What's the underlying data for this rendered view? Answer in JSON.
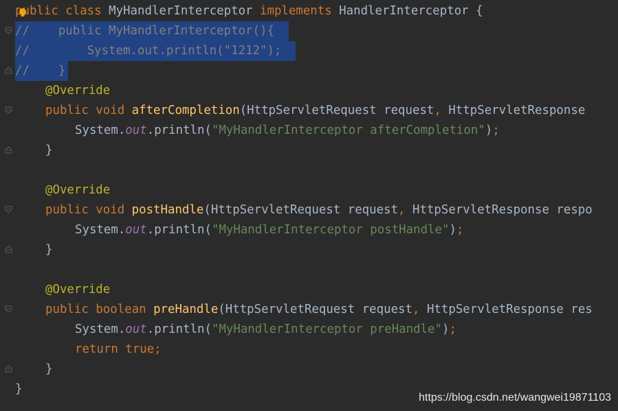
{
  "editor": {
    "lines": [
      {
        "t": "public",
        "c": "kw"
      },
      {
        "t": "class",
        "c": "kw"
      },
      {
        "t": "MyHandlerInterceptor",
        "c": ""
      },
      {
        "t": "implements",
        "c": "kw"
      },
      {
        "t": "HandlerInterceptor",
        "c": ""
      },
      {
        "t": "{",
        "c": ""
      }
    ],
    "code": {
      "l1": [
        "public",
        " class ",
        "MyHandlerInterceptor ",
        "implements ",
        "HandlerInterceptor {"
      ],
      "l2": "//    public MyHandlerInterceptor(){",
      "l3": "//        System.out.println(\"1212\");",
      "l4": "//    }",
      "l5": [
        "@Override"
      ],
      "l6": [
        "public void ",
        "afterCompletion",
        "(HttpServletRequest request",
        ", ",
        "HttpServletResponse "
      ],
      "l7": [
        "System.",
        "out",
        ".println(",
        "\"MyHandlerInterceptor afterCompletion\"",
        ")",
        ";"
      ],
      "l8": "}",
      "l10": [
        "@Override"
      ],
      "l11": [
        "public void ",
        "postHandle",
        "(HttpServletRequest request",
        ", ",
        "HttpServletResponse respo"
      ],
      "l12": [
        "System.",
        "out",
        ".println(",
        "\"MyHandlerInterceptor postHandle\"",
        ")",
        ";"
      ],
      "l13": "}",
      "l15": [
        "@Override"
      ],
      "l16": [
        "public boolean ",
        "preHandle",
        "(HttpServletRequest request",
        ", ",
        "HttpServletResponse res"
      ],
      "l17": [
        "System.",
        "out",
        ".println(",
        "\"MyHandlerInterceptor preHandle\"",
        ")",
        ";"
      ],
      "l18": [
        "return true",
        ";"
      ],
      "l19": "}",
      "l20": "}"
    }
  },
  "icons": {
    "bulb": "lightbulb-icon",
    "fold": "fold-marker-icon"
  },
  "colors": {
    "background": "#2b2b2b",
    "selection": "#214283",
    "keyword": "#cc7832",
    "annotation": "#bbb529",
    "method": "#ffc66d",
    "string": "#6a8759",
    "field": "#9876aa",
    "comment": "#808080",
    "text": "#a9b7c6"
  },
  "watermark": "https://blog.csdn.net/wangwei19871103"
}
